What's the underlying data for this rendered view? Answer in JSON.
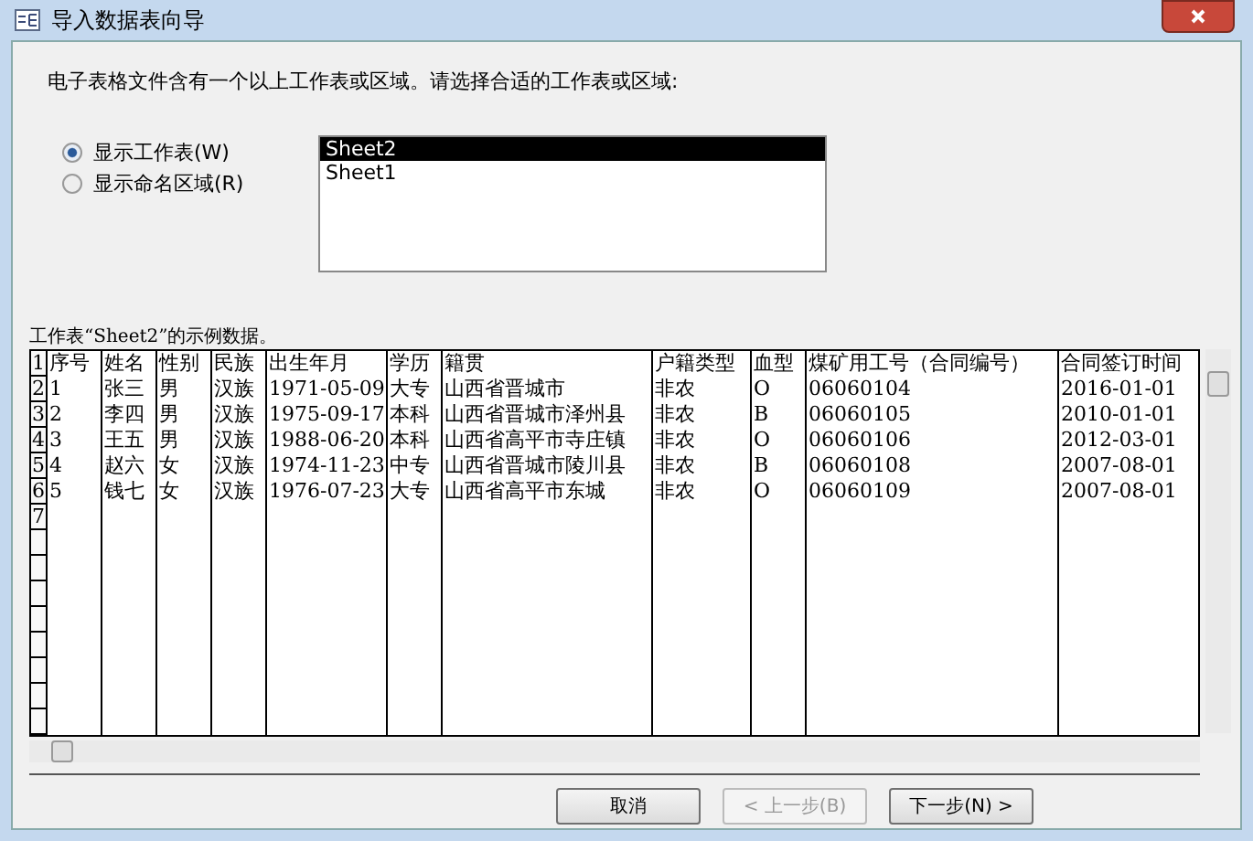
{
  "window": {
    "title": "导入数据表向导"
  },
  "instruction": "电子表格文件含有一个以上工作表或区域。请选择合适的工作表或区域:",
  "options": [
    {
      "label": "显示工作表(W)",
      "selected": true
    },
    {
      "label": "显示命名区域(R)",
      "selected": false
    }
  ],
  "sheets": [
    {
      "label": "Sheet2",
      "selected": true
    },
    {
      "label": "Sheet1",
      "selected": false
    }
  ],
  "preview_label": "工作表“Sheet2”的示例数据。",
  "table": {
    "row_numbers": [
      "1",
      "2",
      "3",
      "4",
      "5",
      "6",
      "7"
    ],
    "columns": [
      "序号",
      "姓名",
      "性别",
      "民族",
      "出生年月",
      "学历",
      "籍贯",
      "户籍类型",
      "血型",
      "煤矿用工号（合同编号）",
      "合同签订时间"
    ],
    "rows": [
      [
        "1",
        "张三",
        "男",
        "汉族",
        "1971-05-09",
        "大专",
        "山西省晋城市",
        "非农",
        "O",
        "06060104",
        "2016-01-01"
      ],
      [
        "2",
        "李四",
        "男",
        "汉族",
        "1975-09-17",
        "本科",
        "山西省晋城市泽州县",
        "非农",
        "B",
        "06060105",
        "2010-01-01"
      ],
      [
        "3",
        "王五",
        "男",
        "汉族",
        "1988-06-20",
        "本科",
        "山西省高平市寺庄镇",
        "非农",
        "O",
        "06060106",
        "2012-03-01"
      ],
      [
        "4",
        "赵六",
        "女",
        "汉族",
        "1974-11-23",
        "中专",
        "山西省晋城市陵川县",
        "非农",
        "B",
        "06060108",
        "2007-08-01"
      ],
      [
        "5",
        "钱七",
        "女",
        "汉族",
        "1976-07-23",
        "大专",
        "山西省高平市东城",
        "非农",
        "O",
        "06060109",
        "2007-08-01"
      ]
    ]
  },
  "buttons": [
    {
      "label": "取消",
      "disabled": false
    },
    {
      "label": "< 上一步(B)",
      "disabled": true
    },
    {
      "label": "下一步(N) >",
      "disabled": false
    }
  ]
}
